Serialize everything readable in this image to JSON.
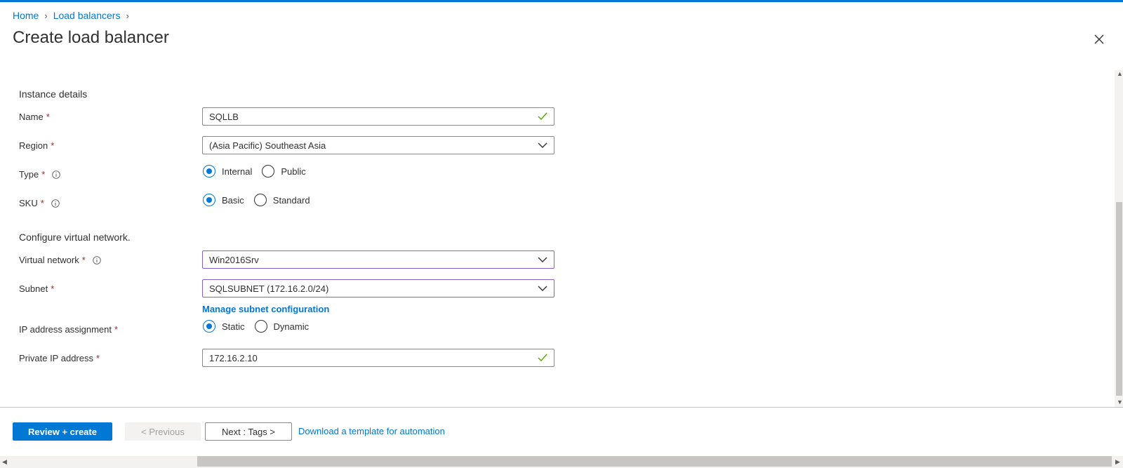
{
  "breadcrumb": {
    "home": "Home",
    "load_balancers": "Load balancers"
  },
  "page": {
    "title": "Create load balancer"
  },
  "form": {
    "instance_details": "Instance details",
    "name": {
      "label": "Name",
      "value": "SQLLB"
    },
    "region": {
      "label": "Region",
      "value": "(Asia Pacific) Southeast Asia"
    },
    "type": {
      "label": "Type",
      "options": [
        "Internal",
        "Public"
      ],
      "selected": "Internal"
    },
    "sku": {
      "label": "SKU",
      "options": [
        "Basic",
        "Standard"
      ],
      "selected": "Basic"
    },
    "configure_vnet": "Configure virtual network.",
    "virtual_network": {
      "label": "Virtual network",
      "value": "Win2016Srv"
    },
    "subnet": {
      "label": "Subnet",
      "value": "SQLSUBNET (172.16.2.0/24)"
    },
    "manage_subnet": "Manage subnet configuration",
    "ip_assignment": {
      "label": "IP address assignment",
      "options": [
        "Static",
        "Dynamic"
      ],
      "selected": "Static"
    },
    "private_ip": {
      "label": "Private IP address",
      "value": "172.16.2.10"
    },
    "required_mark": "*"
  },
  "footer": {
    "review_create": "Review + create",
    "previous": "< Previous",
    "next": "Next : Tags >",
    "download_template": "Download a template for automation"
  },
  "colors": {
    "accent": "#0078d4",
    "required": "#a4262c",
    "valid": "#57a300",
    "focus_border": "#8661c5"
  },
  "icons": [
    "chevron-right-icon",
    "close-icon",
    "checkmark-icon",
    "chevron-down-icon",
    "info-icon"
  ]
}
